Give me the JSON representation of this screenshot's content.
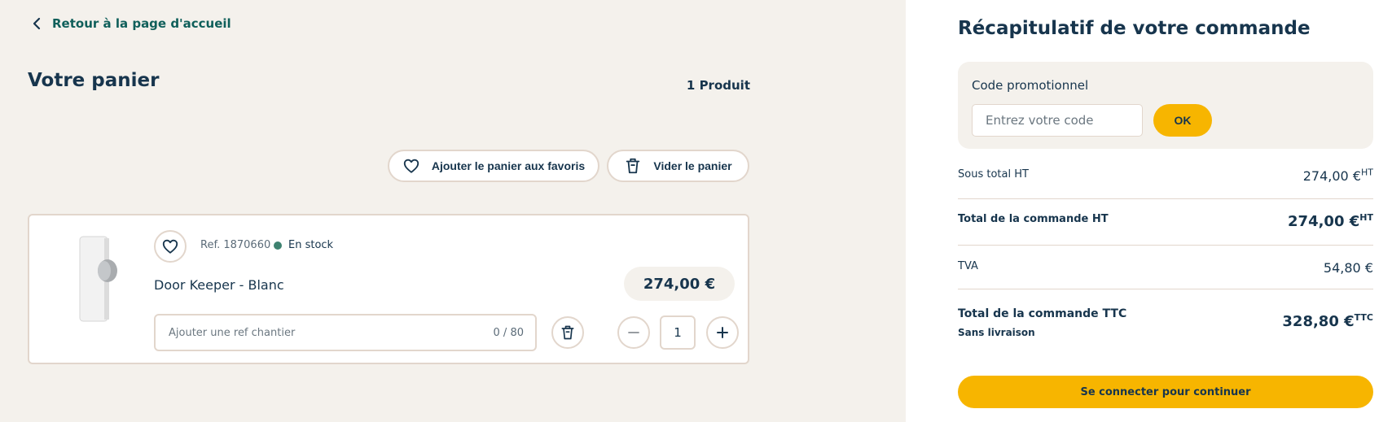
{
  "nav": {
    "back_label": "Retour à la page d'accueil"
  },
  "cart": {
    "title": "Votre panier",
    "count": "1 Produit",
    "fav_cart_label": "Ajouter le panier aux favoris",
    "clear_cart_label": "Vider le panier",
    "items": [
      {
        "ref": "Ref. 1870660",
        "stock": "En stock",
        "name": "Door Keeper - Blanc",
        "price": "274,00 €",
        "ref_chantier_placeholder": "Ajouter une ref chantier",
        "ref_chantier_counter": "0 / 80",
        "quantity": "1"
      }
    ]
  },
  "summary": {
    "title": "Récapitulatif de votre commande",
    "promo_label": "Code promotionnel",
    "promo_placeholder": "Entrez votre code",
    "promo_button": "OK",
    "subtotal_label": "Sous total HT",
    "subtotal_value": "274,00 €",
    "subtotal_suffix": "HT",
    "total_ht_label": "Total de la commande HT",
    "total_ht_value": "274,00 €",
    "total_ht_suffix": "HT",
    "tva_label": "TVA",
    "tva_value": "54,80 €",
    "total_ttc_label": "Total de la commande TTC",
    "total_ttc_sub": "Sans livraison",
    "total_ttc_value": "328,80 €",
    "total_ttc_suffix": "TTC",
    "cta_label": "Se connecter pour continuer"
  },
  "colors": {
    "accent_yellow": "#f7b500",
    "text_navy": "#17354d",
    "link_teal": "#0f5f5a",
    "stock_green": "#3e8270",
    "page_beige": "#f4f1ec",
    "border_beige": "#e2d6cc"
  }
}
